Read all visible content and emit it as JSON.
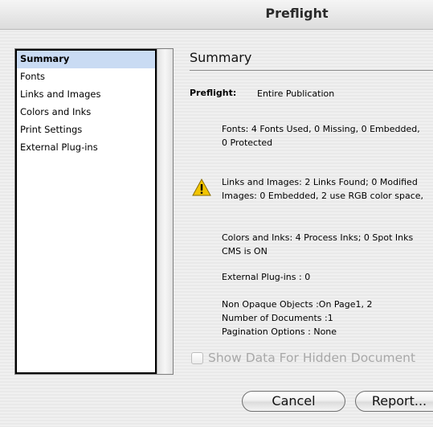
{
  "window": {
    "title": "Preflight"
  },
  "sidebar": {
    "items": [
      {
        "label": "Summary",
        "selected": true
      },
      {
        "label": "Fonts",
        "selected": false
      },
      {
        "label": "Links and Images",
        "selected": false
      },
      {
        "label": "Colors and Inks",
        "selected": false
      },
      {
        "label": "Print Settings",
        "selected": false
      },
      {
        "label": "External Plug-ins",
        "selected": false
      }
    ]
  },
  "summary": {
    "heading": "Summary",
    "preflight_label": "Preflight:",
    "preflight_value": "Entire Publication",
    "fonts": {
      "line1": "Fonts: 4 Fonts Used, 0 Missing, 0 Embedded,",
      "line2": "0 Protected"
    },
    "links": {
      "line1": "Links and Images: 2 Links Found; 0 Modified",
      "line2": "Images: 0 Embedded, 2 use RGB color space,",
      "icon": "warning-icon"
    },
    "colors": {
      "line1": "Colors and Inks: 4 Process Inks; 0 Spot Inks",
      "line2": "CMS is ON"
    },
    "plugins": {
      "line1": "External Plug-ins : 0"
    },
    "other": {
      "line1": "Non Opaque Objects :On Page1, 2",
      "line2": "Number of Documents :1",
      "line3": "Pagination Options : None"
    }
  },
  "options": {
    "show_hidden_label": "Show Data For Hidden Document",
    "show_hidden_checked": false
  },
  "buttons": {
    "cancel": "Cancel",
    "report": "Report..."
  },
  "colors": {
    "selection": "#c9dbf3",
    "warning": "#f2c500"
  }
}
